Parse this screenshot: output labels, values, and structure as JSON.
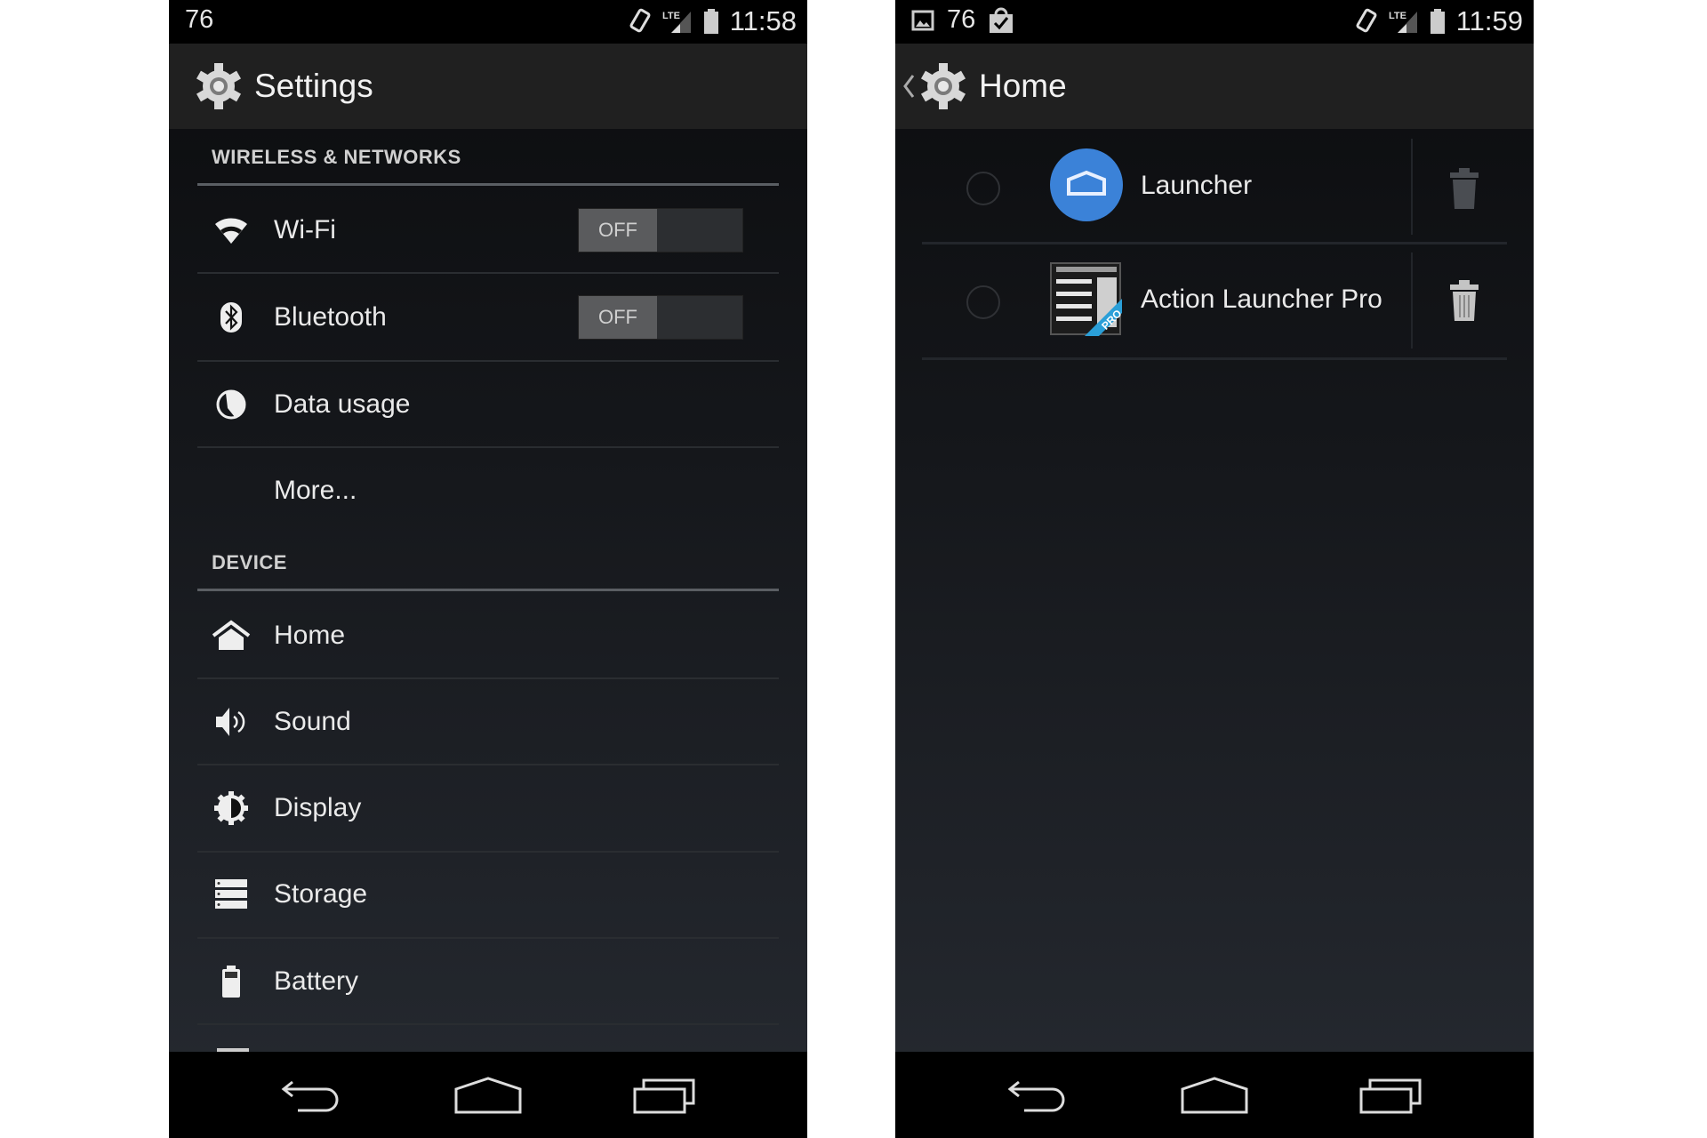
{
  "left_screen": {
    "status_bar": {
      "left_text": "76",
      "time": "11:58",
      "icons": [
        "rotate-icon",
        "lte-signal-icon",
        "battery-icon"
      ]
    },
    "action_bar": {
      "title": "Settings",
      "icon": "settings-gear-icon"
    },
    "sections": [
      {
        "title": "WIRELESS & NETWORKS",
        "items": [
          {
            "label": "Wi-Fi",
            "icon": "wifi-icon",
            "toggle": "OFF"
          },
          {
            "label": "Bluetooth",
            "icon": "bluetooth-icon",
            "toggle": "OFF"
          },
          {
            "label": "Data usage",
            "icon": "data-usage-icon"
          },
          {
            "label": "More...",
            "icon": ""
          }
        ]
      },
      {
        "title": "DEVICE",
        "items": [
          {
            "label": "Home",
            "icon": "home-icon"
          },
          {
            "label": "Sound",
            "icon": "sound-icon"
          },
          {
            "label": "Display",
            "icon": "display-icon"
          },
          {
            "label": "Storage",
            "icon": "storage-icon"
          },
          {
            "label": "Battery",
            "icon": "battery-icon"
          }
        ]
      }
    ],
    "nav": [
      "back",
      "home",
      "recents"
    ]
  },
  "right_screen": {
    "status_bar": {
      "left_text": "76",
      "time": "11:59",
      "icons": [
        "gallery-icon",
        "shopping-bag-check-icon",
        "rotate-icon",
        "lte-signal-icon",
        "battery-icon"
      ]
    },
    "action_bar": {
      "title": "Home",
      "icon": "settings-gear-icon",
      "up_icon": "chevron-left-icon"
    },
    "apps": [
      {
        "label": "Launcher",
        "icon": "launcher-icon",
        "selected": false,
        "delete_enabled": false
      },
      {
        "label": "Action Launcher Pro",
        "icon": "action-launcher-pro-icon",
        "icon_badge": "PRO",
        "selected": false,
        "delete_enabled": true
      }
    ],
    "nav": [
      "back",
      "home",
      "recents"
    ]
  },
  "colors": {
    "launcher_blue": "#3b82d8",
    "badge_blue": "#2a9fd8",
    "toggle_off": "#5a5b5d"
  }
}
